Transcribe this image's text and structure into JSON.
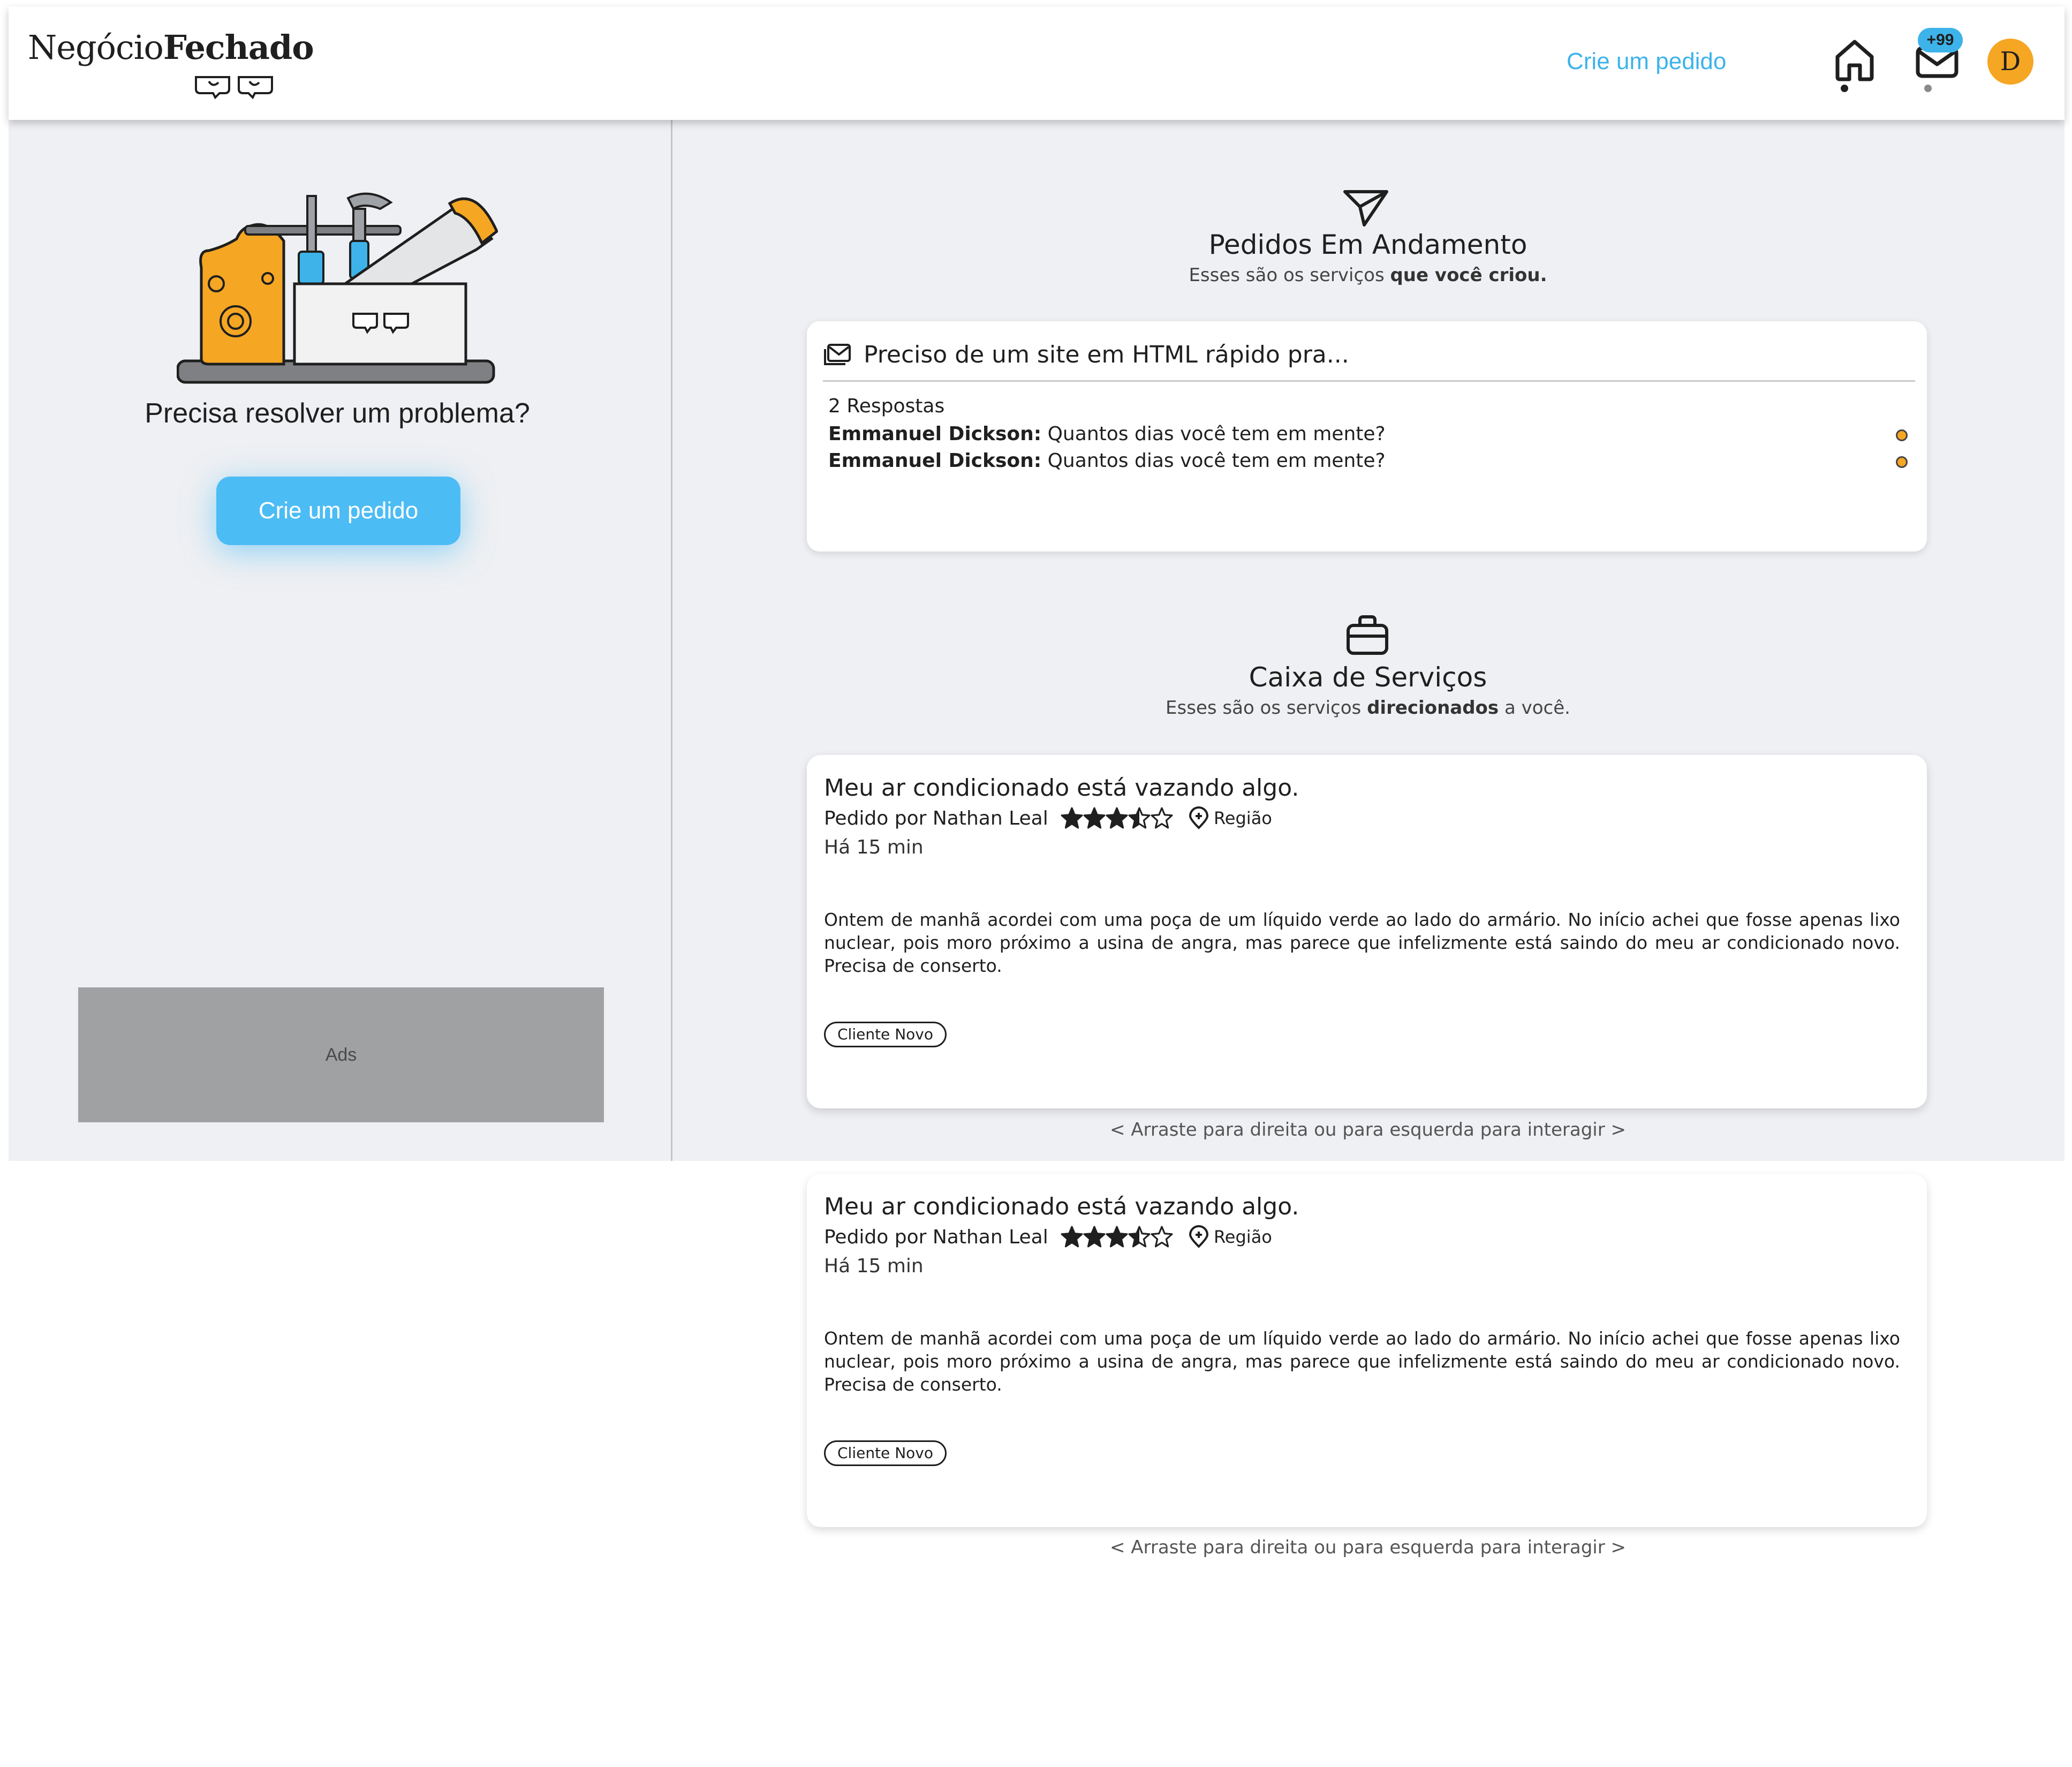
{
  "header": {
    "logo_regular": "Negócio",
    "logo_bold": "Fechado",
    "create_link": "Crie um pedido",
    "mail_badge": "+99",
    "avatar_initial": "D"
  },
  "left_panel": {
    "title": "Precisa resolver um problema?",
    "cta_label": "Crie um pedido",
    "ads_label": "Ads"
  },
  "orders_section": {
    "title": "Pedidos Em Andamento",
    "subtitle_prefix": "Esses são os serviços ",
    "subtitle_bold": "que você criou.",
    "card": {
      "title": "Preciso de um site em HTML rápido pra...",
      "responses": "2 Respostas",
      "messages": [
        {
          "author": "Emmanuel Dickson:",
          "text": " Quantos dias você tem em mente?"
        },
        {
          "author": "Emmanuel Dickson:",
          "text": " Quantos dias você tem em mente?"
        }
      ]
    }
  },
  "services_section": {
    "title": "Caixa de Serviços",
    "subtitle_prefix": "Esses são os serviços ",
    "subtitle_bold": "direcionados",
    "subtitle_suffix": " a você.",
    "cards": [
      {
        "title": "Meu ar condicionado está vazando algo.",
        "requested_by": "Pedido por Nathan Leal",
        "rating": 3.5,
        "region": "Região",
        "time": "Há 15 min",
        "description": "Ontem de manhã acordei com uma poça de um líquido verde ao lado do armário. No início achei que fosse apenas lixo nuclear, pois moro próximo a usina de angra, mas parece que infelizmente está saindo do meu ar condicionado novo. Precisa de conserto.",
        "tag": "Cliente Novo",
        "swipe_hint": "<  Arraste para direita ou para esquerda para interagir  >"
      },
      {
        "title": "Meu ar condicionado está vazando algo.",
        "requested_by": "Pedido por Nathan Leal",
        "rating": 3.5,
        "region": "Região",
        "time": "Há 15 min",
        "description": "Ontem de manhã acordei com uma poça de um líquido verde ao lado do armário. No início achei que fosse apenas lixo nuclear, pois moro próximo a usina de angra, mas parece que infelizmente está saindo do meu ar condicionado novo. Precisa de conserto.",
        "tag": "Cliente Novo",
        "swipe_hint": "<  Arraste para direita ou para esquerda para interagir  >"
      }
    ]
  },
  "colors": {
    "accent_blue": "#3db3ea",
    "button_blue": "#4cbcf5",
    "avatar_orange": "#f5a623",
    "panel_gray": "#eff0f3",
    "ads_gray": "#a0a1a3"
  },
  "icons": [
    "handshake-logo-icon",
    "home-icon",
    "mail-icon",
    "send-icon",
    "inbox-icon",
    "briefcase-icon",
    "star-icon",
    "location-pin-icon",
    "toolbox-illustration"
  ]
}
